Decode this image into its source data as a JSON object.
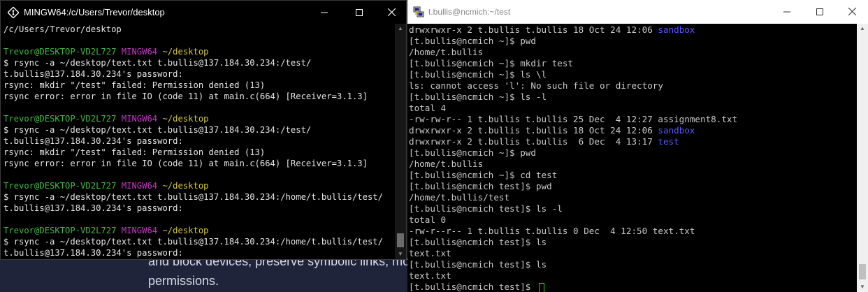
{
  "background": {
    "lines": [
      "and block devices, preserve symbolic links, mod",
      "permissions."
    ]
  },
  "mingw": {
    "title": "MINGW64:/c/Users/Trevor/desktop",
    "lines": [
      {
        "segs": [
          {
            "t": "/c/Users/Trevor/desktop"
          }
        ]
      },
      {
        "segs": [
          {
            "t": ""
          }
        ]
      },
      {
        "segs": [
          {
            "t": "Trevor@DESKTOP-VD2L727 ",
            "c": "green"
          },
          {
            "t": "MINGW64 ",
            "c": "magenta"
          },
          {
            "t": "~/desktop",
            "c": "yellow"
          }
        ]
      },
      {
        "segs": [
          {
            "t": "$ rsync -a ~/desktop/text.txt t.bullis@137.184.30.234:/test/"
          }
        ]
      },
      {
        "segs": [
          {
            "t": "t.bullis@137.184.30.234's password:"
          }
        ]
      },
      {
        "segs": [
          {
            "t": "rsync: mkdir \"/test\" failed: Permission denied (13)"
          }
        ]
      },
      {
        "segs": [
          {
            "t": "rsync error: error in file IO (code 11) at main.c(664) [Receiver=3.1.3]"
          }
        ]
      },
      {
        "segs": [
          {
            "t": ""
          }
        ]
      },
      {
        "segs": [
          {
            "t": "Trevor@DESKTOP-VD2L727 ",
            "c": "green"
          },
          {
            "t": "MINGW64 ",
            "c": "magenta"
          },
          {
            "t": "~/desktop",
            "c": "yellow"
          }
        ]
      },
      {
        "segs": [
          {
            "t": "$ rsync -a ~/desktop/text.txt t.bullis@137.184.30.234:/test/"
          }
        ]
      },
      {
        "segs": [
          {
            "t": "t.bullis@137.184.30.234's password:"
          }
        ]
      },
      {
        "segs": [
          {
            "t": "rsync: mkdir \"/test\" failed: Permission denied (13)"
          }
        ]
      },
      {
        "segs": [
          {
            "t": "rsync error: error in file IO (code 11) at main.c(664) [Receiver=3.1.3]"
          }
        ]
      },
      {
        "segs": [
          {
            "t": ""
          }
        ]
      },
      {
        "segs": [
          {
            "t": "Trevor@DESKTOP-VD2L727 ",
            "c": "green"
          },
          {
            "t": "MINGW64 ",
            "c": "magenta"
          },
          {
            "t": "~/desktop",
            "c": "yellow"
          }
        ]
      },
      {
        "segs": [
          {
            "t": "$ rsync -a ~/desktop/text.txt t.bullis@137.184.30.234:/home/t.bullis/test/"
          }
        ]
      },
      {
        "segs": [
          {
            "t": "t.bullis@137.184.30.234's password:"
          }
        ]
      },
      {
        "segs": [
          {
            "t": ""
          }
        ]
      },
      {
        "segs": [
          {
            "t": "Trevor@DESKTOP-VD2L727 ",
            "c": "green"
          },
          {
            "t": "MINGW64 ",
            "c": "magenta"
          },
          {
            "t": "~/desktop",
            "c": "yellow"
          }
        ]
      },
      {
        "segs": [
          {
            "t": "$ rsync -a ~/desktop/text.txt t.bullis@137.184.30.234:/home/t.bullis/test/"
          }
        ]
      },
      {
        "segs": [
          {
            "t": "t.bullis@137.184.30.234's password:"
          }
        ]
      },
      {
        "segs": [
          {
            "t": ""
          }
        ]
      },
      {
        "segs": [
          {
            "t": "Trevor@DESKTOP-VD2L727 ",
            "c": "green"
          },
          {
            "t": "MINGW64 ",
            "c": "magenta"
          },
          {
            "t": "~/desktop",
            "c": "yellow"
          }
        ]
      },
      {
        "segs": [
          {
            "t": "$ "
          }
        ],
        "cursor": true
      }
    ]
  },
  "putty": {
    "title": "t.bullis@ncmich:~/test",
    "lines": [
      {
        "segs": [
          {
            "t": "drwxrwxr-x 2 t.bullis t.bullis 18 Oct 24 12:06 "
          },
          {
            "t": "sandbox",
            "c": "blue"
          }
        ]
      },
      {
        "segs": [
          {
            "t": "[t.bullis@ncmich ~]$ pwd"
          }
        ]
      },
      {
        "segs": [
          {
            "t": "/home/t.bullis"
          }
        ]
      },
      {
        "segs": [
          {
            "t": "[t.bullis@ncmich ~]$ mkdir test"
          }
        ]
      },
      {
        "segs": [
          {
            "t": "[t.bullis@ncmich ~]$ ls \\l"
          }
        ]
      },
      {
        "segs": [
          {
            "t": "ls: cannot access 'l': No such file or directory"
          }
        ]
      },
      {
        "segs": [
          {
            "t": "[t.bullis@ncmich ~]$ ls -l"
          }
        ]
      },
      {
        "segs": [
          {
            "t": "total 4"
          }
        ]
      },
      {
        "segs": [
          {
            "t": "-rw-rw-r-- 1 t.bullis t.bullis 25 Dec  4 12:27 assignment8.txt"
          }
        ]
      },
      {
        "segs": [
          {
            "t": "drwxrwxr-x 2 t.bullis t.bullis 18 Oct 24 12:06 "
          },
          {
            "t": "sandbox",
            "c": "blue"
          }
        ]
      },
      {
        "segs": [
          {
            "t": "drwxrwxr-x 2 t.bullis t.bullis  6 Dec  4 13:17 "
          },
          {
            "t": "test",
            "c": "blue"
          }
        ]
      },
      {
        "segs": [
          {
            "t": "[t.bullis@ncmich ~]$ pwd"
          }
        ]
      },
      {
        "segs": [
          {
            "t": "/home/t.bullis"
          }
        ]
      },
      {
        "segs": [
          {
            "t": "[t.bullis@ncmich ~]$ cd test"
          }
        ]
      },
      {
        "segs": [
          {
            "t": "[t.bullis@ncmich test]$ pwd"
          }
        ]
      },
      {
        "segs": [
          {
            "t": "/home/t.bullis/test"
          }
        ]
      },
      {
        "segs": [
          {
            "t": "[t.bullis@ncmich test]$ ls -l"
          }
        ]
      },
      {
        "segs": [
          {
            "t": "total 0"
          }
        ]
      },
      {
        "segs": [
          {
            "t": "-rw-r--r-- 1 t.bullis t.bullis 0 Dec  4 12:50 text.txt"
          }
        ]
      },
      {
        "segs": [
          {
            "t": "[t.bullis@ncmich test]$ ls"
          }
        ]
      },
      {
        "segs": [
          {
            "t": "text.txt"
          }
        ]
      },
      {
        "segs": [
          {
            "t": "[t.bullis@ncmich test]$ ls"
          }
        ]
      },
      {
        "segs": [
          {
            "t": "text.txt"
          }
        ]
      },
      {
        "segs": [
          {
            "t": "[t.bullis@ncmich test]$ "
          }
        ],
        "cursor": true
      }
    ]
  },
  "colors": {
    "green": "#3fb940",
    "magenta": "#c338c3",
    "yellow": "#d7c83a",
    "blue": "#5555ff"
  },
  "window_controls": {
    "minimize": "─",
    "maximize": "☐",
    "close": "✕"
  }
}
